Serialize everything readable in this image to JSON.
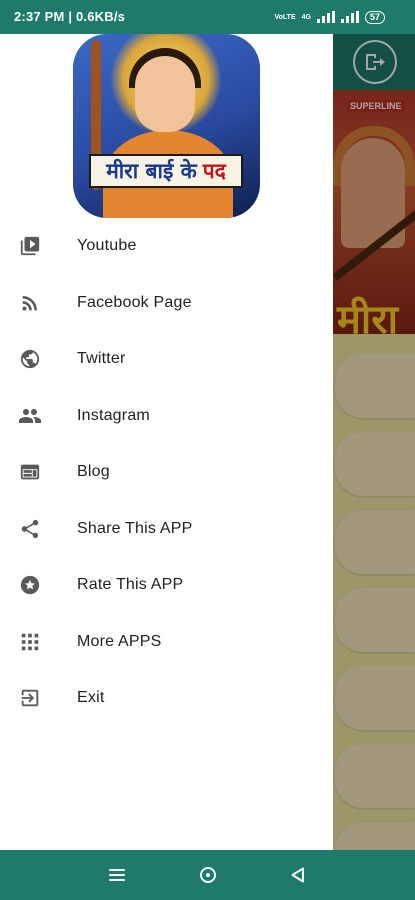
{
  "status_bar": {
    "time": "2:37 PM | 0.6KB/s",
    "network_tag": "4G",
    "battery": "57"
  },
  "app_logo": {
    "title_part1": "मीरा बाई के",
    "title_part2": "पद"
  },
  "background": {
    "banner_tag": "SUPERLINE",
    "banner_title": "मीरा"
  },
  "menu": {
    "items": [
      {
        "label": "Youtube",
        "icon": "youtube-icon"
      },
      {
        "label": "Facebook Page",
        "icon": "rss-feed-icon"
      },
      {
        "label": "Twitter",
        "icon": "globe-icon"
      },
      {
        "label": "Instagram",
        "icon": "people-icon"
      },
      {
        "label": "Blog",
        "icon": "web-page-icon"
      },
      {
        "label": "Share This APP",
        "icon": "share-icon"
      },
      {
        "label": "Rate This APP",
        "icon": "star-circle-icon"
      },
      {
        "label": "More APPS",
        "icon": "apps-grid-icon"
      },
      {
        "label": "Exit",
        "icon": "exit-icon"
      }
    ]
  },
  "colors": {
    "primary": "#1f7a6a",
    "drawer_bg": "#ffffff",
    "icon": "#5a5a5a",
    "text": "#222222"
  }
}
